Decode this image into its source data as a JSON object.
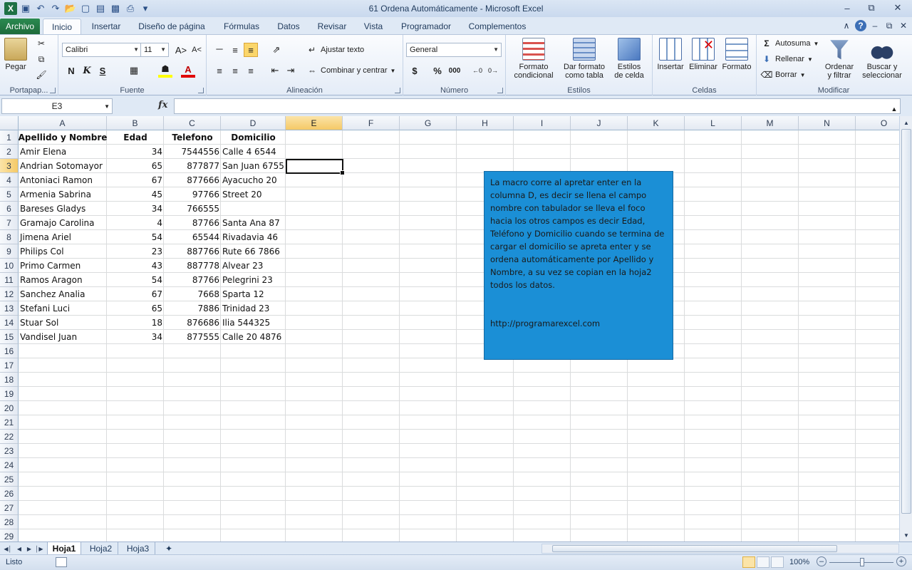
{
  "window": {
    "title": "61 Ordena Automáticamente - Microsoft Excel"
  },
  "tabs": {
    "file": "Archivo",
    "items": [
      "Inicio",
      "Insertar",
      "Diseño de página",
      "Fórmulas",
      "Datos",
      "Revisar",
      "Vista",
      "Programador",
      "Complementos"
    ],
    "active": "Inicio"
  },
  "ribbon": {
    "clipboard": {
      "label": "Portapap...",
      "paste": "Pegar"
    },
    "font": {
      "label": "Fuente",
      "name": "Calibri",
      "size": "11",
      "bold": "N",
      "italic": "K",
      "underline": "S"
    },
    "alignment": {
      "label": "Alineación",
      "wrap": "Ajustar texto",
      "merge": "Combinar y centrar"
    },
    "number": {
      "label": "Número",
      "format": "General",
      "currency": "$",
      "percent": "%",
      "thousands": "000"
    },
    "styles": {
      "label": "Estilos",
      "conditional": [
        "Formato",
        "condicional"
      ],
      "table": [
        "Dar formato",
        "como tabla"
      ],
      "cell": [
        "Estilos",
        "de celda"
      ]
    },
    "cells": {
      "label": "Celdas",
      "insert": "Insertar",
      "delete": "Eliminar",
      "format": "Formato"
    },
    "editing": {
      "label": "Modificar",
      "autosum": "Autosuma",
      "fill": "Rellenar",
      "clear": "Borrar",
      "sort": [
        "Ordenar",
        "y filtrar"
      ],
      "find": [
        "Buscar y",
        "seleccionar"
      ]
    }
  },
  "formula_bar": {
    "name_box": "E3",
    "fx": "fx",
    "value": ""
  },
  "columns": [
    "A",
    "B",
    "C",
    "D",
    "E",
    "F",
    "G",
    "H",
    "I",
    "J",
    "K",
    "L",
    "M",
    "N",
    "O"
  ],
  "rows": [
    "1",
    "2",
    "3",
    "4",
    "5",
    "6",
    "7",
    "8",
    "9",
    "10",
    "11",
    "12",
    "13",
    "14",
    "15",
    "16",
    "17",
    "18",
    "19",
    "20",
    "21",
    "22",
    "23",
    "24",
    "25",
    "26",
    "27",
    "28",
    "29"
  ],
  "selected": {
    "column": "E",
    "row": "3"
  },
  "sheet": {
    "headers": [
      "Apellido y Nombre",
      "Edad",
      "Telefono",
      "Domicilio"
    ],
    "rows": [
      [
        "Amir Elena",
        "34",
        "7544556",
        "Calle 4 6544"
      ],
      [
        "Andrian Sotomayor",
        "65",
        "877877",
        "San Juan 6755"
      ],
      [
        "Antoniaci Ramon",
        "67",
        "877666",
        "Ayacucho 20"
      ],
      [
        "Armenia Sabrina",
        "45",
        "97766",
        "Street 20"
      ],
      [
        "Bareses Gladys",
        "34",
        "766555",
        ""
      ],
      [
        "Gramajo Carolina",
        "4",
        "87766",
        "Santa Ana 87"
      ],
      [
        "Jimena Ariel",
        "54",
        "65544",
        "Rivadavia 46"
      ],
      [
        "Philips Col",
        "23",
        "887766",
        "Rute 66 7866"
      ],
      [
        "Primo Carmen",
        "43",
        "887778",
        "Alvear 23"
      ],
      [
        "Ramos Aragon",
        "54",
        "87766",
        "Pelegrini 23"
      ],
      [
        "Sanchez Analia",
        "67",
        "7668",
        "Sparta 12"
      ],
      [
        "Stefani Luci",
        "65",
        "7886",
        "Trinidad 23"
      ],
      [
        "Stuar Sol",
        "18",
        "876686",
        "Ilia 544325"
      ],
      [
        "Vandisel Juan",
        "34",
        "877555",
        "Calle 20 4876"
      ]
    ]
  },
  "textbox": {
    "body": "La macro corre al apretar enter en la columna D, es decir se llena el campo nombre con tabulador se lleva el foco hacia los otros campos es decir Edad, Teléfono y Domicilio cuando se termina de cargar el domicilio se apreta enter y se ordena automáticamente por Apellido y Nombre, a su vez se copian en la hoja2 todos los datos.",
    "url": "http://programarexcel.com",
    "color": "#1b8fd6"
  },
  "sheet_tabs": [
    "Hoja1",
    "Hoja2",
    "Hoja3"
  ],
  "active_sheet": "Hoja1",
  "status": {
    "text": "Listo",
    "zoom": "100%"
  }
}
